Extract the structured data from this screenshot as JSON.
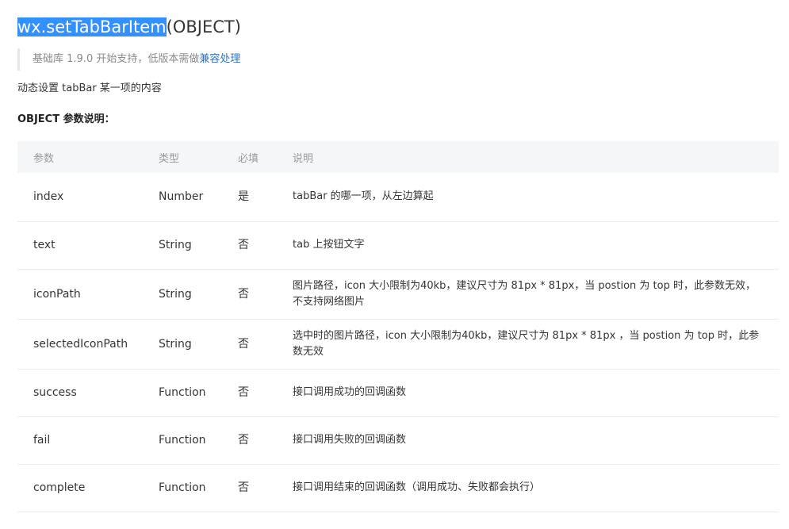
{
  "title": {
    "selected": "wx.setTabBarItem",
    "rest": "(OBJECT)"
  },
  "note": {
    "text": "基础库 1.9.0 开始支持，低版本需做",
    "link": "兼容处理"
  },
  "description": "动态设置 tabBar 某一项的内容",
  "params_heading": "OBJECT 参数说明：",
  "table": {
    "headers": [
      "参数",
      "类型",
      "必填",
      "说明"
    ],
    "rows": [
      {
        "name": "index",
        "type": "Number",
        "required": "是",
        "desc": "tabBar 的哪一项，从左边算起"
      },
      {
        "name": "text",
        "type": "String",
        "required": "否",
        "desc": "tab 上按钮文字"
      },
      {
        "name": "iconPath",
        "type": "String",
        "required": "否",
        "desc": "图片路径，icon 大小限制为40kb，建议尺寸为 81px * 81px，当 postion 为 top 时，此参数无效，不支持网络图片"
      },
      {
        "name": "selectedIconPath",
        "type": "String",
        "required": "否",
        "desc": "选中时的图片路径，icon 大小限制为40kb，建议尺寸为 81px * 81px ，当 postion 为 top 时，此参数无效"
      },
      {
        "name": "success",
        "type": "Function",
        "required": "否",
        "desc": "接口调用成功的回调函数"
      },
      {
        "name": "fail",
        "type": "Function",
        "required": "否",
        "desc": "接口调用失败的回调函数"
      },
      {
        "name": "complete",
        "type": "Function",
        "required": "否",
        "desc": "接口调用结束的回调函数（调用成功、失败都会执行）"
      }
    ]
  }
}
